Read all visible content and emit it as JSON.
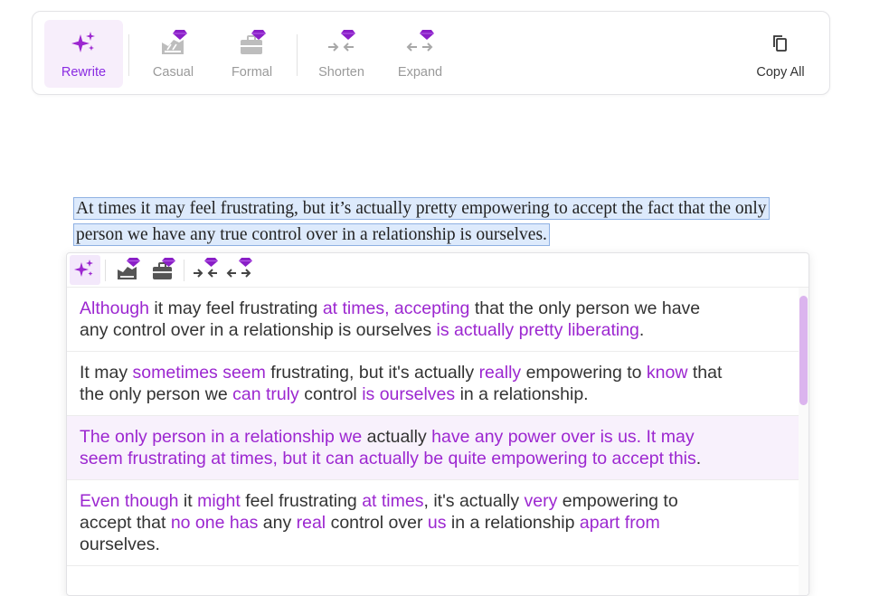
{
  "toolbar": {
    "buttons": [
      {
        "id": "rewrite",
        "label": "Rewrite",
        "icon": "sparkles-icon",
        "premium": false,
        "active": true
      },
      {
        "id": "casual",
        "label": "Casual",
        "icon": "casual-icon",
        "premium": true,
        "active": false
      },
      {
        "id": "formal",
        "label": "Formal",
        "icon": "formal-icon",
        "premium": true,
        "active": false
      },
      {
        "id": "shorten",
        "label": "Shorten",
        "icon": "shorten-icon",
        "premium": true,
        "active": false
      },
      {
        "id": "expand",
        "label": "Expand",
        "icon": "expand-icon",
        "premium": true,
        "active": false
      }
    ],
    "copy_all_label": "Copy All"
  },
  "selected_text": "At times it may feel frustrating, but it’s actually pretty empowering to accept the fact that the only person we have any true control over in a relationship is ourselves.",
  "colors": {
    "accent": "#9c27d0",
    "premium_gem": "#8a1fc7",
    "selection_bg": "#ddeafc",
    "highlight_row": "#f8f1fc"
  },
  "suggestions": [
    {
      "segments": [
        {
          "t": "Although",
          "c": true
        },
        {
          "t": " it may feel frustrating ",
          "c": false
        },
        {
          "t": "at times, accepting",
          "c": true
        },
        {
          "t": " that the only person we have any control over in a relationship is ourselves ",
          "c": false
        },
        {
          "t": "is actually pretty liberating",
          "c": true
        },
        {
          "t": ".",
          "c": false
        }
      ]
    },
    {
      "segments": [
        {
          "t": "It may ",
          "c": false
        },
        {
          "t": "sometimes seem",
          "c": true
        },
        {
          "t": " frustrating, but it's actually ",
          "c": false
        },
        {
          "t": "really",
          "c": true
        },
        {
          "t": " empowering to ",
          "c": false
        },
        {
          "t": "know",
          "c": true
        },
        {
          "t": " that the only person we ",
          "c": false
        },
        {
          "t": "can truly",
          "c": true
        },
        {
          "t": " control ",
          "c": false
        },
        {
          "t": "is ourselves",
          "c": true
        },
        {
          "t": " in a relationship.",
          "c": false
        }
      ]
    },
    {
      "highlighted": true,
      "segments": [
        {
          "t": "The only person in a relationship we",
          "c": true
        },
        {
          "t": " actually ",
          "c": false
        },
        {
          "t": "have any power over is us. It may seem frustrating at times, but it can actually be quite empowering to accept this",
          "c": true
        },
        {
          "t": ".",
          "c": false
        }
      ]
    },
    {
      "segments": [
        {
          "t": "Even though",
          "c": true
        },
        {
          "t": " it ",
          "c": false
        },
        {
          "t": "might",
          "c": true
        },
        {
          "t": " feel frustrating ",
          "c": false
        },
        {
          "t": "at times",
          "c": true
        },
        {
          "t": ", it's actually ",
          "c": false
        },
        {
          "t": "very",
          "c": true
        },
        {
          "t": " empowering to accept that ",
          "c": false
        },
        {
          "t": "no one has",
          "c": true
        },
        {
          "t": " any ",
          "c": false
        },
        {
          "t": "real",
          "c": true
        },
        {
          "t": " control over ",
          "c": false
        },
        {
          "t": "us",
          "c": true
        },
        {
          "t": " in a relationship ",
          "c": false
        },
        {
          "t": "apart from",
          "c": true
        },
        {
          "t": " ourselves.",
          "c": false
        }
      ]
    }
  ]
}
